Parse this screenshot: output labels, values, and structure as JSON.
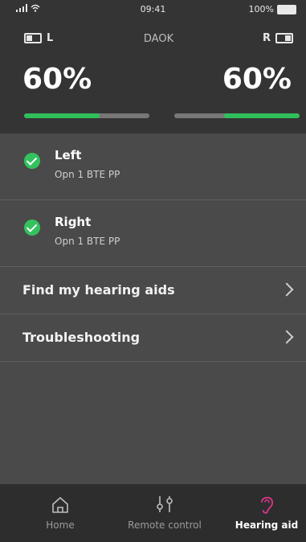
{
  "status_bar": {
    "time": "09:41",
    "battery": "100%"
  },
  "header": {
    "device_name": "DAOK",
    "left": {
      "side_label": "L",
      "percent_text": "60%",
      "level": 0.6
    },
    "right": {
      "side_label": "R",
      "percent_text": "60%",
      "level": 0.6
    }
  },
  "devices": [
    {
      "name": "Left",
      "model": "Opn 1 BTE PP"
    },
    {
      "name": "Right",
      "model": "Opn 1 BTE PP"
    }
  ],
  "links": [
    {
      "label": "Find my hearing aids"
    },
    {
      "label": "Troubleshooting"
    }
  ],
  "tabbar": {
    "items": [
      {
        "label": "Home",
        "icon": "home-icon"
      },
      {
        "label": "Remote control",
        "icon": "sliders-icon"
      },
      {
        "label": "Hearing aid",
        "icon": "hearing-aid-icon"
      }
    ],
    "active_color": "#e0368c"
  },
  "colors": {
    "battery_fill": "#2fbf5a",
    "check": "#34c25e"
  }
}
